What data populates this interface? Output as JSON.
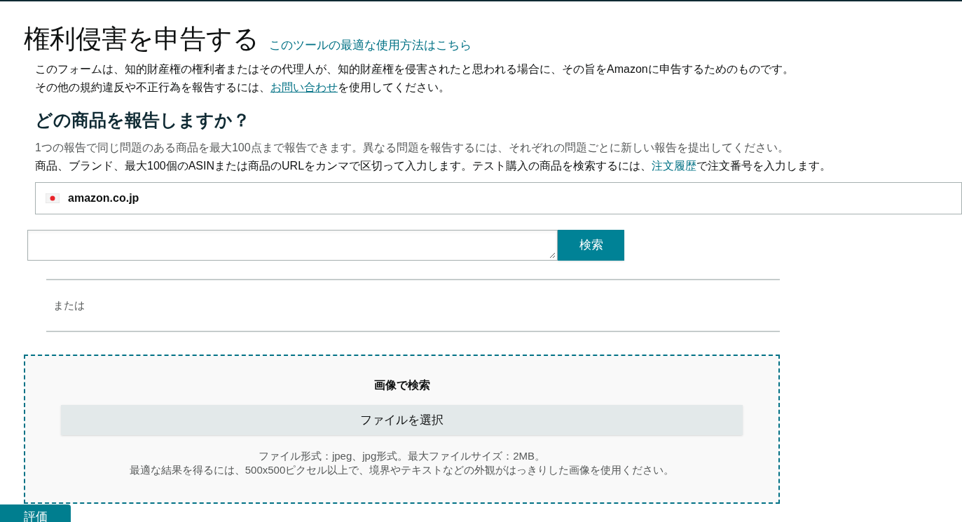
{
  "header": {
    "title": "権利侵害を申告する",
    "help_link": "このツールの最適な使用方法はこちら"
  },
  "intro": {
    "line1": "このフォームは、知的財産権の権利者またはその代理人が、知的財産権を侵害されたと思われる場合に、その旨をAmazonに申告するためのものです。",
    "line2_before": "その他の規約違反や不正行為を報告するには、",
    "line2_link": "お問い合わせ",
    "line2_after": "を使用してください。"
  },
  "section": {
    "heading": "どの商品を報告しますか？",
    "note": "1つの報告で同じ問題のある商品を最大100点まで報告できます。異なる問題を報告するには、それぞれの問題ごとに新しい報告を提出してください。",
    "hint_before": "商品、ブランド、最大100個のASINまたは商品のURLをカンマで区切って入力します。テスト購入の商品を検索するには、",
    "hint_link": "注文履歴",
    "hint_after": "で注文番号を入力します。"
  },
  "marketplace": {
    "label": "amazon.co.jp"
  },
  "search": {
    "button": "検索"
  },
  "divider_text": "または",
  "image_search": {
    "title": "画像で検索",
    "button": "ファイルを選択",
    "note1": "ファイル形式：jpeg、jpg形式。最大ファイルサイズ：2MB。",
    "note2": "最適な結果を得るには、500x500ピクセル以上で、境界やテキストなどの外観がはっきりした画像を使用ください。"
  },
  "feedback": {
    "label": "評価"
  }
}
